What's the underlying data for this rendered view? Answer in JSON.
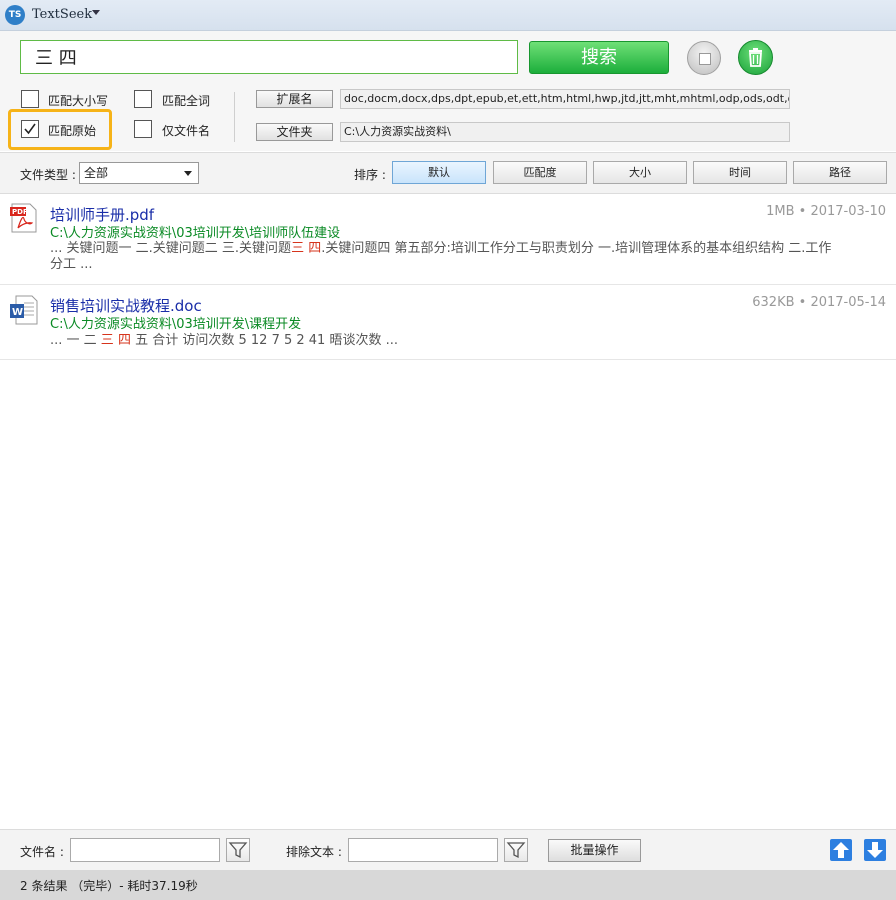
{
  "app": {
    "title": "TextSeek",
    "logo_text": "TS"
  },
  "search": {
    "query": "三 四",
    "button_label": "搜索"
  },
  "options": {
    "match_case": {
      "label": "匹配大小写",
      "checked": false
    },
    "match_whole_word": {
      "label": "匹配全词",
      "checked": false
    },
    "match_original": {
      "label": "匹配原始",
      "checked": true
    },
    "filename_only": {
      "label": "仅文件名",
      "checked": false
    }
  },
  "extension": {
    "label": "扩展名",
    "value": "doc,docm,docx,dps,dpt,epub,et,ett,htm,html,hwp,jtd,jtt,mht,mhtml,odp,ods,odt,ofd,p"
  },
  "folder": {
    "label": "文件夹",
    "value": "C:\\人力资源实战资料\\"
  },
  "filter": {
    "file_type_label": "文件类型 :",
    "file_type_value": "全部",
    "sort_label": "排序 :",
    "sort_buttons": [
      "默认",
      "匹配度",
      "大小",
      "时间",
      "路径"
    ],
    "active_sort": "默认"
  },
  "results": [
    {
      "title": "培训师手册.pdf",
      "path": "C:\\人力资源实战资料\\03培训开发\\培训师队伍建设",
      "meta": "1MB • 2017-03-10",
      "icon": "pdf-file-icon",
      "snippet_line1_before": "... 关键问题一 二.关键问题二 三.关键问题",
      "snippet_line1_m1": "三",
      "snippet_line1_sp": " ",
      "snippet_line1_m2": "四",
      "snippet_line1_after": ".关键问题四 第五部分:培训工作分工与职责划分 一.培训管理体系的基本组织结构 二.工作",
      "snippet_line2": "分工 ..."
    },
    {
      "title": "销售培训实战教程.doc",
      "path": "C:\\人力资源实战资料\\03培训开发\\课程开发",
      "meta": "632KB • 2017-05-14",
      "icon": "word-file-icon",
      "snippet_before": "... 一 二 ",
      "snippet_m1": "三",
      "snippet_sp": " ",
      "snippet_m2": "四",
      "snippet_after": " 五 合计 访问次数 5 12 7 5 2 41 晤谈次数 ..."
    }
  ],
  "bottom": {
    "filename_label": "文件名 :",
    "filename_value": "",
    "exclude_label": "排除文本 :",
    "exclude_value": "",
    "batch_label": "批量操作"
  },
  "status": {
    "text": "2 条结果 （完毕）- 耗时37.19秒"
  },
  "colors": {
    "accent_green": "#1cae3b",
    "highlight_orange": "#f6b318",
    "match_red": "#d6341c",
    "title_blue": "#1a2ea8",
    "path_green": "#0a8a24"
  }
}
